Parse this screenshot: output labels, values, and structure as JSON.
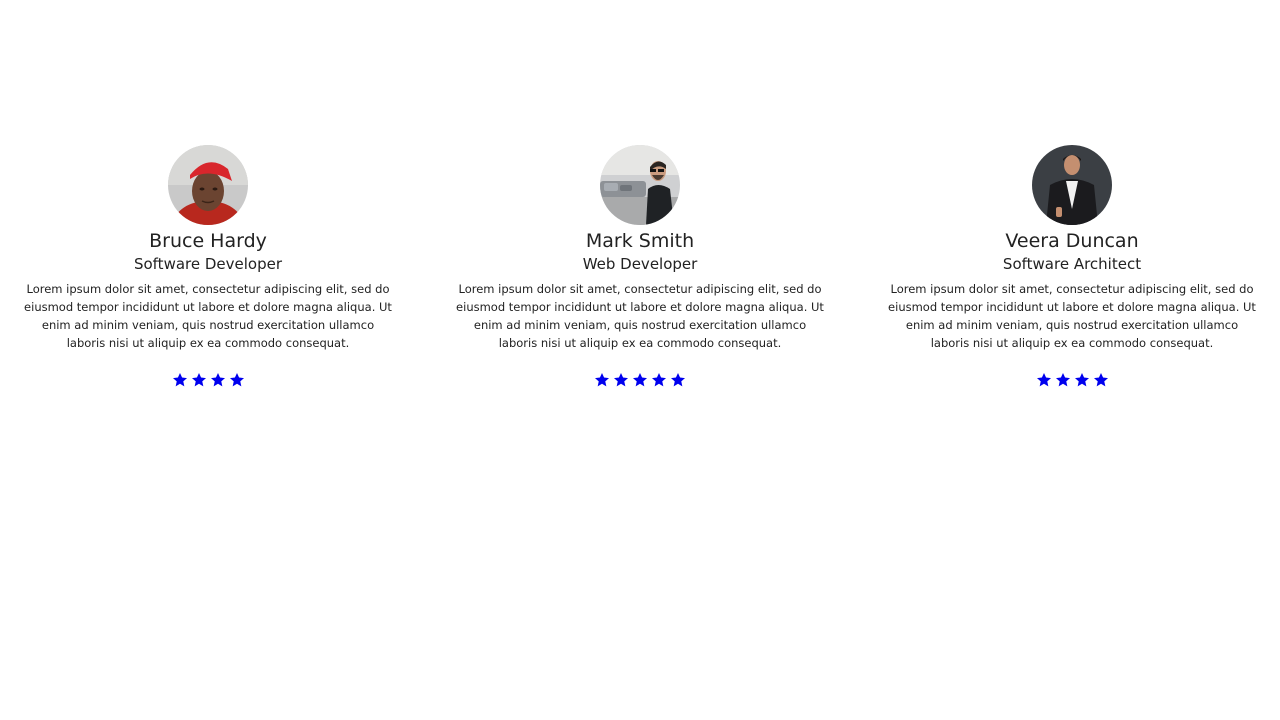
{
  "colors": {
    "star": "#0000ee",
    "text": "#222222",
    "background": "#ffffff"
  },
  "testimonials": [
    {
      "avatar_icon": "avatar-red-bandana-photo",
      "name": "Bruce Hardy",
      "role": "Software Developer",
      "bio": "Lorem ipsum dolor sit amet, consectetur adipiscing elit, sed do eiusmod tempor incididunt ut labore et dolore magna aliqua. Ut enim ad minim veniam, quis nostrud exercitation ullamco laboris nisi ut aliquip ex ea commodo consequat.",
      "rating": 4
    },
    {
      "avatar_icon": "avatar-street-photo",
      "name": "Mark Smith",
      "role": "Web Developer",
      "bio": "Lorem ipsum dolor sit amet, consectetur adipiscing elit, sed do eiusmod tempor incididunt ut labore et dolore magna aliqua. Ut enim ad minim veniam, quis nostrud exercitation ullamco laboris nisi ut aliquip ex ea commodo consequat.",
      "rating": 5
    },
    {
      "avatar_icon": "avatar-suit-photo",
      "name": "Veera Duncan",
      "role": "Software Architect",
      "bio": "Lorem ipsum dolor sit amet, consectetur adipiscing elit, sed do eiusmod tempor incididunt ut labore et dolore magna aliqua. Ut enim ad minim veniam, quis nostrud exercitation ullamco laboris nisi ut aliquip ex ea commodo consequat.",
      "rating": 4
    }
  ]
}
